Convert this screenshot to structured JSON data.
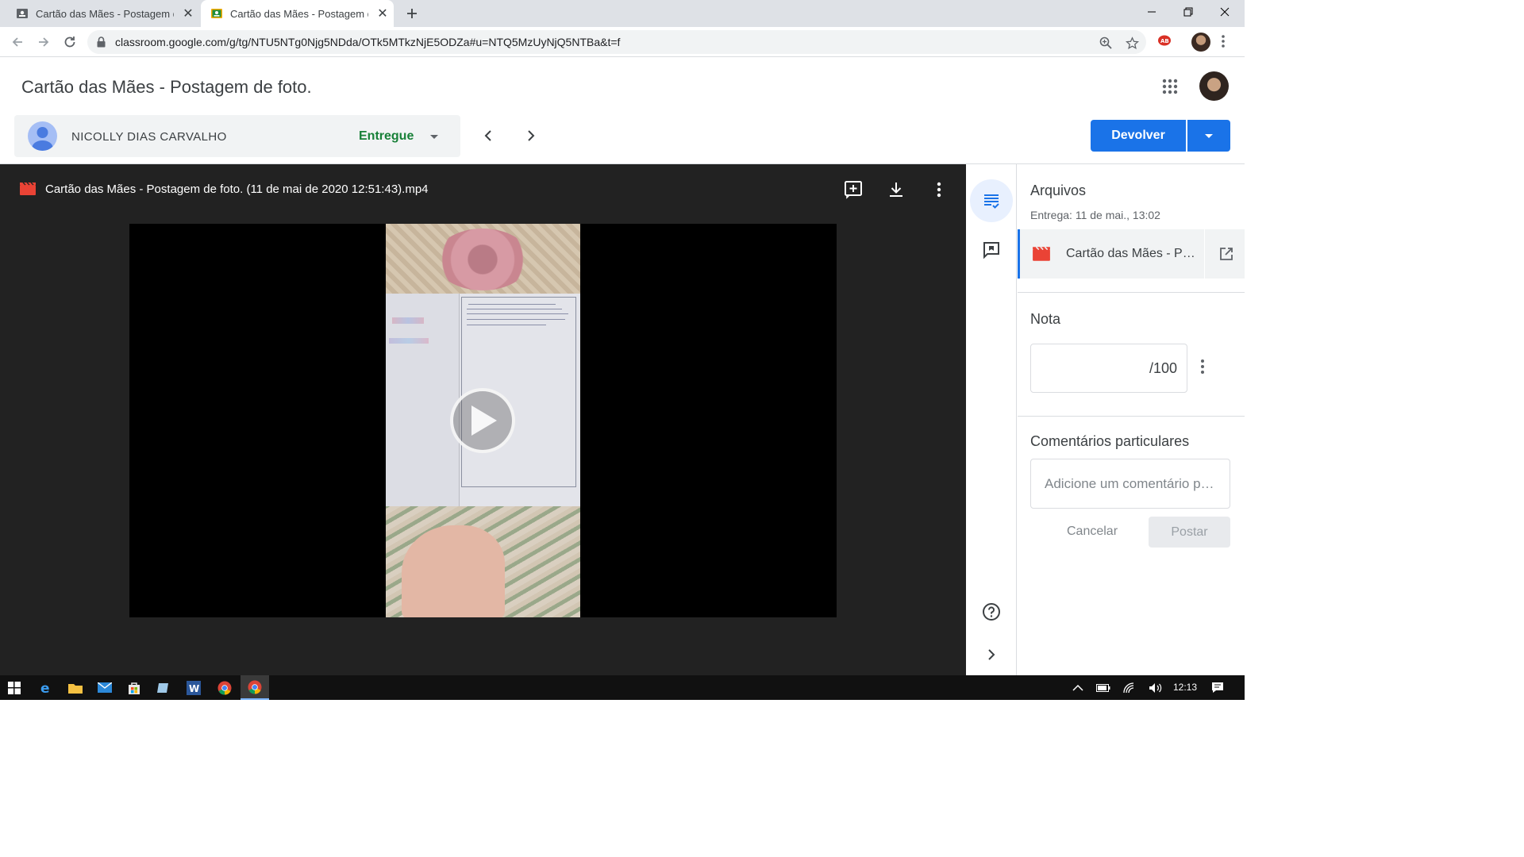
{
  "browser": {
    "tabs": [
      {
        "title": "Cartão das Mães - Postagem de foto."
      },
      {
        "title": "Cartão das Mães - Postagem de foto."
      }
    ],
    "url": "classroom.google.com/g/tg/NTU5NTg0Njg5NDda/OTk5MTkzNjE5ODZa#u=NTQ5MzUyNjQ5NTBa&t=f",
    "icons": [
      "back-icon",
      "forward-icon",
      "reload-icon",
      "lock-icon",
      "zoom-icon",
      "star-icon",
      "extension-icon",
      "menu-icon"
    ]
  },
  "header": {
    "title": "Cartão das Mães - Postagem de foto.",
    "student": {
      "name": "NICOLLY DIAS CARVALHO",
      "status": "Entregue"
    },
    "return_label": "Devolver",
    "colors": {
      "accent": "#1a73e8",
      "status": "#188038"
    }
  },
  "viewer": {
    "file_title": "Cartão das Mães - Postagem de foto. (11 de mai de 2020 12:51:43).mp4"
  },
  "panel": {
    "files_heading": "Arquivos",
    "submitted": "Entrega: 11 de mai., 13:02",
    "file_name": "Cartão das Mães - Postagem de foto. (11 de mai de 2020 12:51:43).mp4",
    "grade_heading": "Nota",
    "grade_suffix": "/100",
    "comments_heading": "Comentários particulares",
    "comment_placeholder": "Adicione um comentário particular...",
    "cancel_label": "Cancelar",
    "post_label": "Postar"
  },
  "taskbar": {
    "time": "12:13"
  }
}
